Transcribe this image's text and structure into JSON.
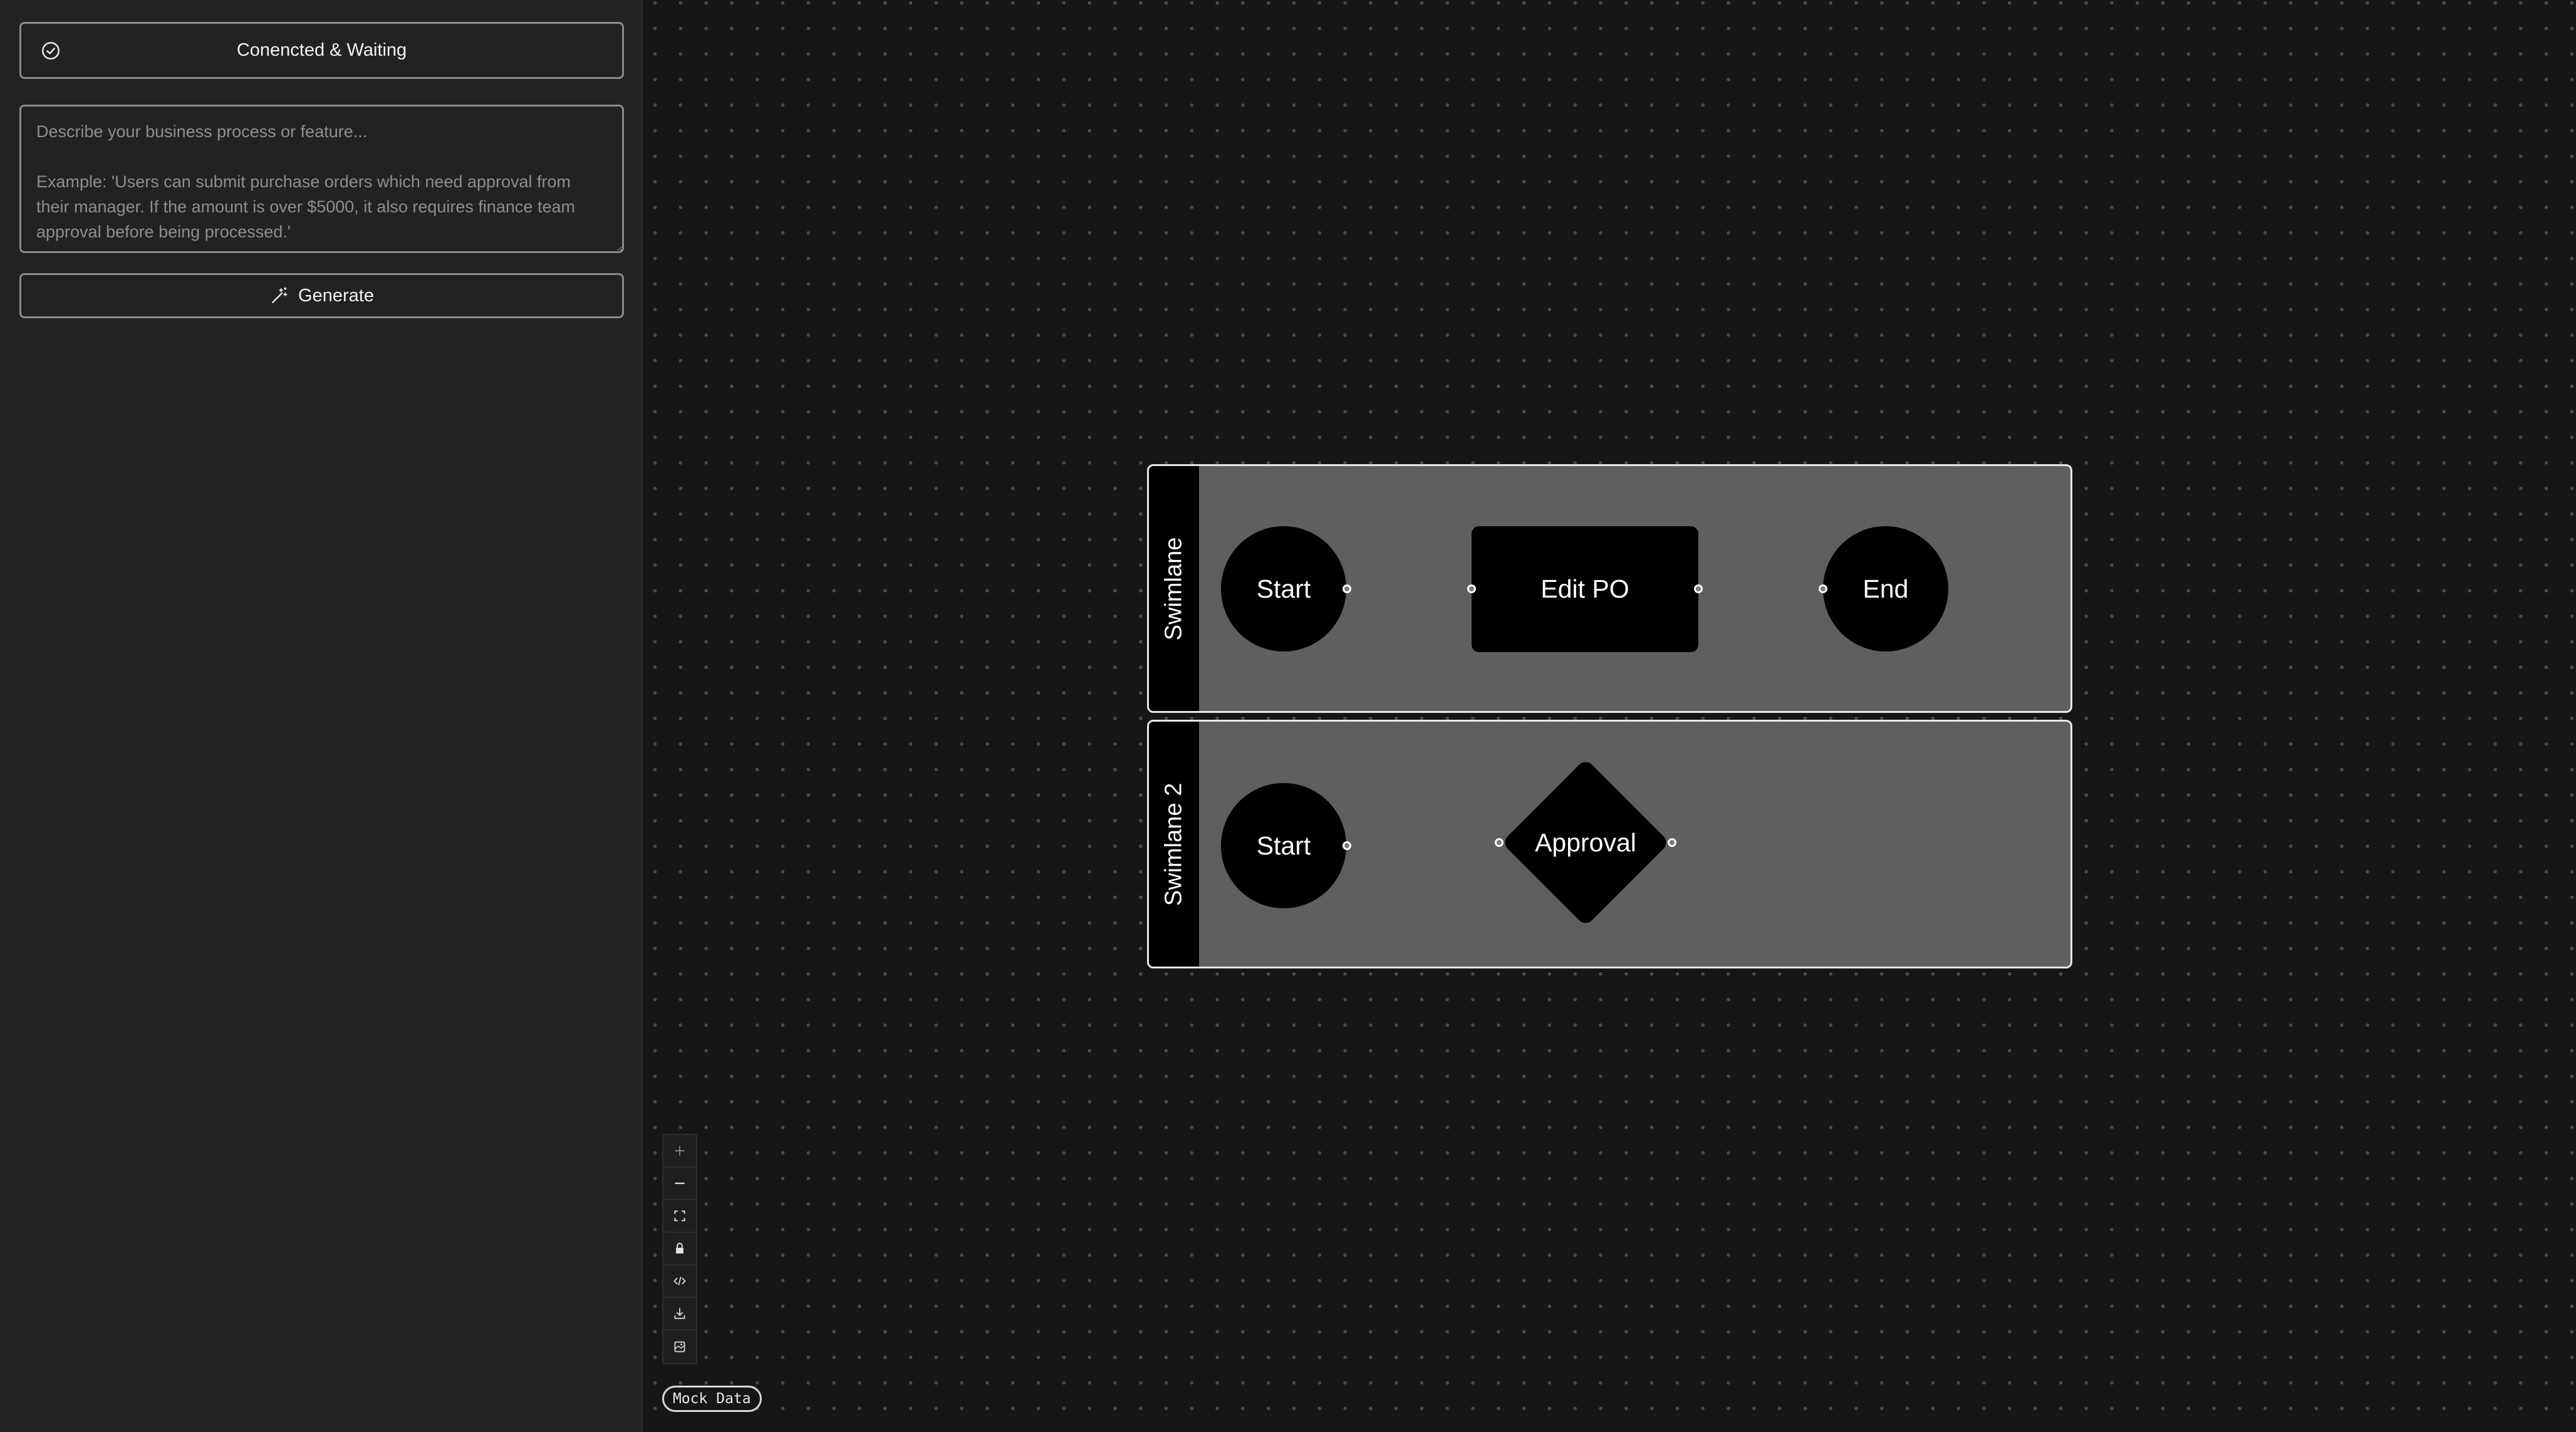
{
  "sidebar": {
    "status_label": "Conencted & Waiting",
    "status_icon": "check-circle-icon",
    "input": {
      "value": "",
      "placeholder": "Describe your business process or feature...\n\nExample: 'Users can submit purchase orders which need approval from their manager. If the amount is over $5000, it also requires finance team approval before being processed.'"
    },
    "generate_label": "Generate",
    "generate_icon": "magic-wand-icon"
  },
  "flow": {
    "lanes": [
      {
        "title": "Swimlane",
        "nodes": [
          {
            "label": "Start",
            "shape": "circle"
          },
          {
            "label": "Edit PO",
            "shape": "rectangle"
          },
          {
            "label": "End",
            "shape": "circle"
          }
        ]
      },
      {
        "title": "Swimlane 2",
        "nodes": [
          {
            "label": "Start",
            "shape": "circle"
          },
          {
            "label": "Approval",
            "shape": "diamond"
          }
        ]
      }
    ],
    "edges": [
      {
        "from": "Start",
        "to": "Edit PO",
        "style": "dashed"
      },
      {
        "from": "Edit PO",
        "to": "End",
        "style": "dashed"
      },
      {
        "from": "Start",
        "to": "Approval",
        "style": "dashed"
      }
    ]
  },
  "controls": [
    {
      "name": "zoom-in-icon"
    },
    {
      "name": "zoom-out-icon"
    },
    {
      "name": "fit-view-icon"
    },
    {
      "name": "lock-icon"
    },
    {
      "name": "code-icon"
    },
    {
      "name": "download-icon"
    },
    {
      "name": "image-export-icon"
    }
  ],
  "badge": {
    "label": "Mock Data"
  },
  "colors": {
    "canvas_bg": "#161616",
    "sidebar_bg": "#222222",
    "lane_bg": "#5f5f5f",
    "node_fill": "#000000",
    "accent_border": "#8c8c8c"
  }
}
